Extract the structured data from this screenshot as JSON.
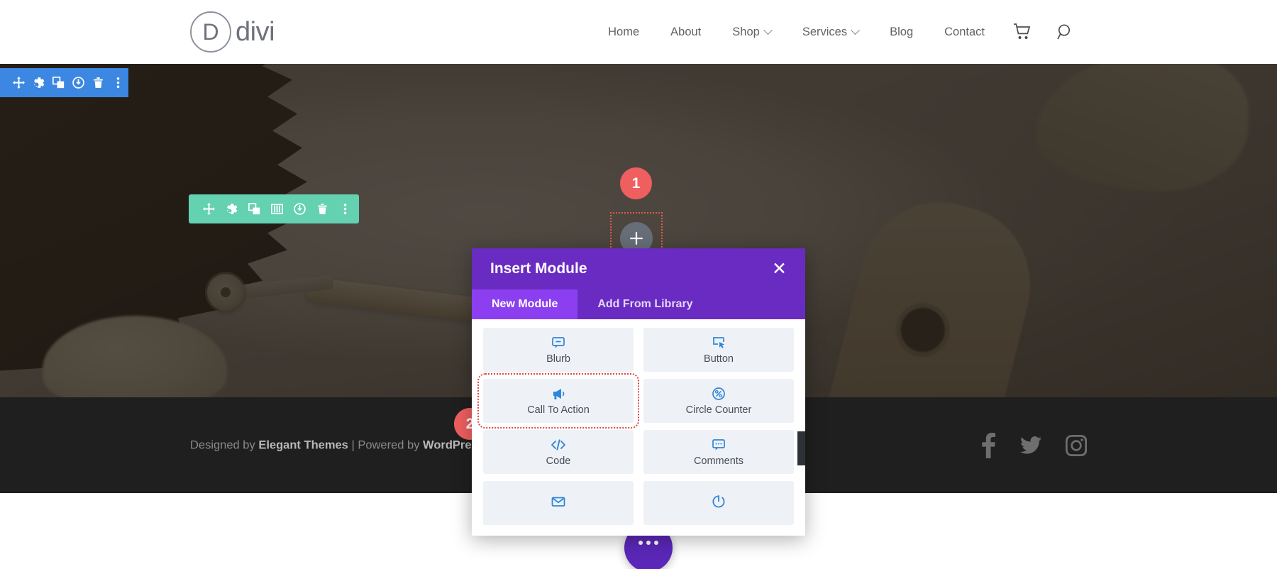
{
  "header": {
    "logo_mark": "D",
    "logo_text": "divi",
    "nav": [
      {
        "label": "Home",
        "has_dropdown": false
      },
      {
        "label": "About",
        "has_dropdown": false
      },
      {
        "label": "Shop",
        "has_dropdown": true
      },
      {
        "label": "Services",
        "has_dropdown": true
      },
      {
        "label": "Blog",
        "has_dropdown": false
      },
      {
        "label": "Contact",
        "has_dropdown": false
      }
    ],
    "cart_icon": "shopping-cart-icon",
    "search_icon": "search-icon"
  },
  "section_toolbar": {
    "color": "#3b87e2",
    "buttons": [
      {
        "name": "move-handle",
        "icon": "move-icon"
      },
      {
        "name": "settings-button",
        "icon": "gear-icon"
      },
      {
        "name": "duplicate-button",
        "icon": "duplicate-icon"
      },
      {
        "name": "save-to-library-button",
        "icon": "power-icon"
      },
      {
        "name": "delete-button",
        "icon": "trash-icon"
      },
      {
        "name": "more-options-button",
        "icon": "kebab-menu-icon"
      }
    ]
  },
  "row_toolbar": {
    "color": "#64d1b1",
    "buttons": [
      {
        "name": "move-handle",
        "icon": "move-icon"
      },
      {
        "name": "settings-button",
        "icon": "gear-icon"
      },
      {
        "name": "duplicate-button",
        "icon": "duplicate-icon"
      },
      {
        "name": "column-structure-button",
        "icon": "columns-icon"
      },
      {
        "name": "save-to-library-button",
        "icon": "power-icon"
      },
      {
        "name": "delete-button",
        "icon": "trash-icon"
      },
      {
        "name": "more-options-button",
        "icon": "kebab-menu-icon"
      }
    ]
  },
  "annotations": {
    "badge_color": "#ef5f5f",
    "highlight_color": "#e04545",
    "steps": [
      {
        "number": "1",
        "target": "insert-module-button"
      },
      {
        "number": "2",
        "target": "call-to-action-module-card"
      }
    ]
  },
  "insert_button": {
    "icon": "plus-icon",
    "label": ""
  },
  "modal": {
    "title": "Insert Module",
    "close_label": "✕",
    "header_color": "#6a2bc2",
    "active_tab_color": "#8b3ff0",
    "tabs": [
      {
        "label": "New Module",
        "active": true
      },
      {
        "label": "Add From Library",
        "active": false
      }
    ],
    "modules": [
      {
        "label": "Blurb",
        "icon": "blurb-icon",
        "highlighted": false
      },
      {
        "label": "Button",
        "icon": "button-icon",
        "highlighted": false
      },
      {
        "label": "Call To Action",
        "icon": "megaphone-icon",
        "highlighted": true
      },
      {
        "label": "Circle Counter",
        "icon": "circle-counter-icon",
        "highlighted": false
      },
      {
        "label": "Code",
        "icon": "code-icon",
        "highlighted": false
      },
      {
        "label": "Comments",
        "icon": "comments-icon",
        "highlighted": false
      },
      {
        "label": "",
        "icon": "envelope-icon",
        "highlighted": false
      },
      {
        "label": "",
        "icon": "countdown-timer-icon",
        "highlighted": false
      }
    ]
  },
  "footer": {
    "prefix": "Designed by ",
    "brand": "Elegant Themes",
    "separator": " | ",
    "powered_prefix": "Powered by ",
    "powered_brand": "WordPress",
    "social": [
      {
        "name": "facebook-icon"
      },
      {
        "name": "twitter-icon"
      },
      {
        "name": "instagram-icon"
      }
    ]
  },
  "fab": {
    "name": "divi-builder-fab",
    "color": "#5b27b8"
  }
}
